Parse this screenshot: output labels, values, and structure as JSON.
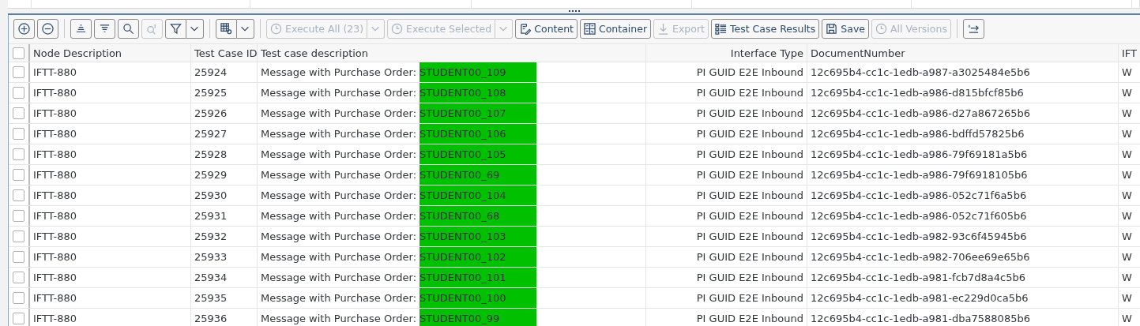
{
  "toolbar": [
    [
      {
        "disabled": false,
        "menu": false
      },
      {
        "disabled": false,
        "menu": false
      }
    ],
    [
      {
        "disabled": false,
        "menu": false
      },
      {
        "disabled": false,
        "menu": false
      },
      {
        "disabled": false,
        "menu": false
      },
      {
        "disabled": true,
        "menu": false
      },
      {
        "disabled": false,
        "menu": true
      }
    ],
    [
      {
        "disabled": false,
        "menu": true
      }
    ],
    [
      {
        "label": "Execute All (23)",
        "disabled": true,
        "menu": true
      },
      {
        "label": "Execute Selected",
        "disabled": true,
        "menu": true
      },
      {
        "label": "Content",
        "disabled": false,
        "menu": false
      },
      {
        "label": "Container",
        "disabled": false,
        "menu": false
      },
      {
        "label": "Export",
        "disabled": true,
        "menu": false
      },
      {
        "label": "Test Case Results",
        "disabled": false,
        "menu": false
      },
      {
        "label": "Save",
        "disabled": false,
        "menu": false
      },
      {
        "label": "All Versions",
        "disabled": true,
        "menu": false
      }
    ],
    [
      {
        "disabled": false,
        "menu": false
      }
    ]
  ],
  "table": {
    "all_checked": false,
    "columns": [
      "Node Description",
      "Test Case ID",
      "Test case description",
      "Interface Type",
      "DocumentNumber",
      "IFT"
    ],
    "rows": [
      {
        "checked": false,
        "node": "IFTT-880",
        "id": "25924",
        "description": "Message with Purchase Order:",
        "order": "STUDENT00_109",
        "highlighted": true,
        "interface": "PI GUID E2E Inbound",
        "document": "12c695b4-cc1c-1edb-a987-a3025484e5b6",
        "column_6": "W"
      },
      {
        "checked": false,
        "node": "IFTT-880",
        "id": "25925",
        "description": "Message with Purchase Order:",
        "order": "STUDENT00_108",
        "highlighted": true,
        "interface": "PI GUID E2E Inbound",
        "document": "12c695b4-cc1c-1edb-a986-d815bfcf85b6",
        "column_6": "W"
      },
      {
        "checked": false,
        "node": "IFTT-880",
        "id": "25926",
        "description": "Message with Purchase Order:",
        "order": "STUDENT00_107",
        "highlighted": true,
        "interface": "PI GUID E2E Inbound",
        "document": "12c695b4-cc1c-1edb-a986-d27a867265b6",
        "column_6": "W"
      },
      {
        "checked": false,
        "node": "IFTT-880",
        "id": "25927",
        "description": "Message with Purchase Order:",
        "order": "STUDENT00_106",
        "highlighted": true,
        "interface": "PI GUID E2E Inbound",
        "document": "12c695b4-cc1c-1edb-a986-bdffd57825b6",
        "column_6": "W"
      },
      {
        "checked": false,
        "node": "IFTT-880",
        "id": "25928",
        "description": "Message with Purchase Order:",
        "order": "STUDENT00_105",
        "highlighted": true,
        "interface": "PI GUID E2E Inbound",
        "document": "12c695b4-cc1c-1edb-a986-79f69181a5b6",
        "column_6": "W"
      },
      {
        "checked": false,
        "node": "IFTT-880",
        "id": "25929",
        "description": "Message with Purchase Order:",
        "order": "STUDENT00_69",
        "highlighted": true,
        "interface": "PI GUID E2E Inbound",
        "document": "12c695b4-cc1c-1edb-a986-79f6918105b6",
        "column_6": "W"
      },
      {
        "checked": false,
        "node": "IFTT-880",
        "id": "25930",
        "description": "Message with Purchase Order:",
        "order": "STUDENT00_104",
        "highlighted": true,
        "interface": "PI GUID E2E Inbound",
        "document": "12c695b4-cc1c-1edb-a986-052c71f6a5b6",
        "column_6": "W"
      },
      {
        "checked": false,
        "node": "IFTT-880",
        "id": "25931",
        "description": "Message with Purchase Order:",
        "order": "STUDENT00_68",
        "highlighted": true,
        "interface": "PI GUID E2E Inbound",
        "document": "12c695b4-cc1c-1edb-a986-052c71f605b6",
        "column_6": "W"
      },
      {
        "checked": false,
        "node": "IFTT-880",
        "id": "25932",
        "description": "Message with Purchase Order:",
        "order": "STUDENT00_103",
        "highlighted": true,
        "interface": "PI GUID E2E Inbound",
        "document": "12c695b4-cc1c-1edb-a982-93c6f45945b6",
        "column_6": "W"
      },
      {
        "checked": false,
        "node": "IFTT-880",
        "id": "25933",
        "description": "Message with Purchase Order:",
        "order": "STUDENT00_102",
        "highlighted": true,
        "interface": "PI GUID E2E Inbound",
        "document": "12c695b4-cc1c-1edb-a982-706ee69e65b6",
        "column_6": "W"
      },
      {
        "checked": false,
        "node": "IFTT-880",
        "id": "25934",
        "description": "Message with Purchase Order:",
        "order": "STUDENT00_101",
        "highlighted": true,
        "interface": "PI GUID E2E Inbound",
        "document": "12c695b4-cc1c-1edb-a981-fcb7d8a4c5b6",
        "column_6": "W"
      },
      {
        "checked": false,
        "node": "IFTT-880",
        "id": "25935",
        "description": "Message with Purchase Order:",
        "order": "STUDENT00_100",
        "highlighted": true,
        "interface": "PI GUID E2E Inbound",
        "document": "12c695b4-cc1c-1edb-a981-ec229d0ca5b6",
        "column_6": "W"
      },
      {
        "checked": false,
        "node": "IFTT-880",
        "id": "25936",
        "description": "Message with Purchase Order:",
        "order": "STUDENT00_99",
        "highlighted": true,
        "interface": "PI GUID E2E Inbound",
        "document": "12c695b4-cc1c-1edb-a981-dba7588085b6",
        "column_6": "W"
      }
    ]
  }
}
